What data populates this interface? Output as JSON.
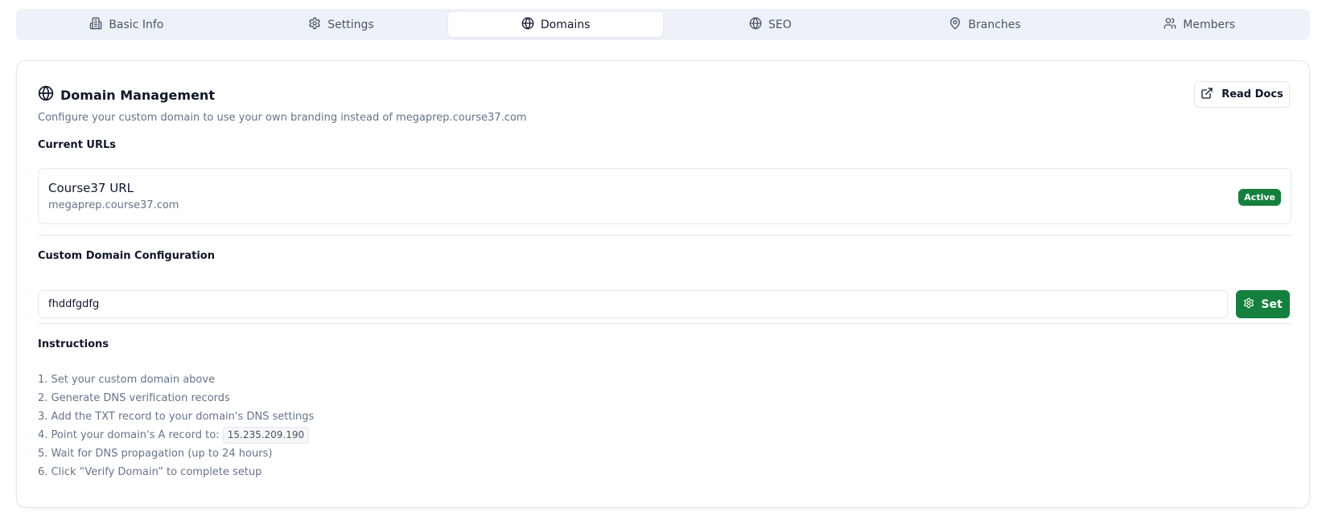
{
  "tabs": [
    {
      "label": "Basic Info",
      "icon": "building-icon",
      "active": false
    },
    {
      "label": "Settings",
      "icon": "gear-icon",
      "active": false
    },
    {
      "label": "Domains",
      "icon": "globe-icon",
      "active": true
    },
    {
      "label": "SEO",
      "icon": "globe-icon",
      "active": false
    },
    {
      "label": "Branches",
      "icon": "map-pin-icon",
      "active": false
    },
    {
      "label": "Members",
      "icon": "users-icon",
      "active": false
    }
  ],
  "card": {
    "title": "Domain Management",
    "description": "Configure your custom domain to use your own branding instead of megaprep.course37.com",
    "docs_button_label": "Read Docs"
  },
  "current_urls": {
    "label": "Current URLs",
    "name": "Course37 URL",
    "url": "megaprep.course37.com",
    "status": "Active"
  },
  "custom_domain": {
    "label": "Custom Domain Configuration",
    "value": "fhddfgdfg",
    "set_button_label": "Set"
  },
  "instructions": {
    "title": "Instructions",
    "steps": [
      "1. Set your custom domain above",
      "2. Generate DNS verification records",
      "3. Add the TXT record to your domain's DNS settings",
      "4. Point your domain's A record to:",
      "5. Wait for DNS propagation (up to 24 hours)",
      "6. Click “Verify Domain” to complete setup"
    ],
    "ip_address": "15.235.209.190"
  },
  "colors": {
    "accent_green": "#15803d",
    "tabbar_bg": "#eef2f8",
    "muted_text": "#64748b",
    "border": "#e2e8f0"
  }
}
